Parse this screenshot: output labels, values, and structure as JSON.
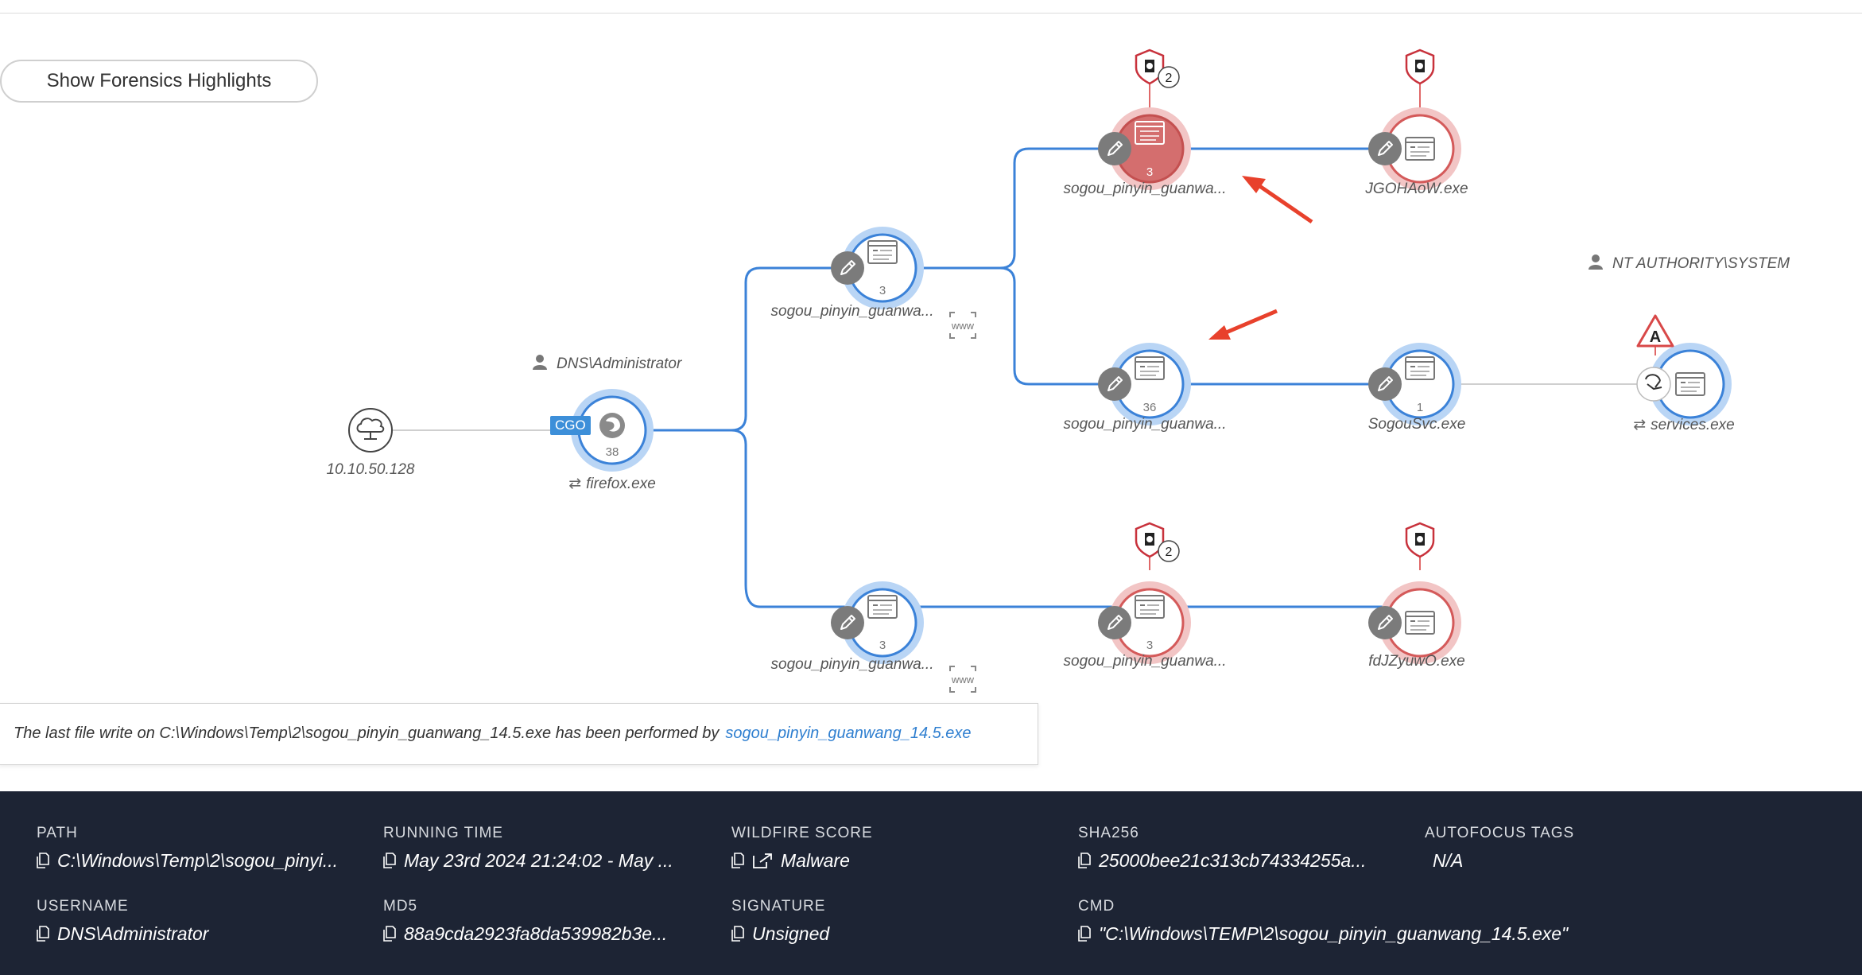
{
  "toolbar": {
    "forensics_button": "Show Forensics Highlights"
  },
  "colors": {
    "edge": "#3b82d8",
    "benign_ring": "#b9d5f5",
    "malicious_ring": "#f2c5c5",
    "malicious_fill": "#d46e6e",
    "panel_bg": "#1d2434",
    "link": "#2f7fd0"
  },
  "users": {
    "dns_admin": "DNS\\Administrator",
    "nt_system": "NT AUTHORITY\\SYSTEM"
  },
  "nodes": {
    "ip": {
      "label": "10.10.50.128",
      "icon": "cloud-network-icon"
    },
    "firefox": {
      "label": "firefox.exe",
      "count": "38",
      "badge": "CGO",
      "icon": "firefox-icon"
    },
    "sogou_a": {
      "label": "sogou_pinyin_guanwa...",
      "count": "3",
      "icon": "window-icon"
    },
    "sogou_b": {
      "label": "sogou_pinyin_guanwa...",
      "count": "3",
      "alerts": "2",
      "icon": "window-icon"
    },
    "jgohaow": {
      "label": "JGOHAoW.exe",
      "icon": "window-icon"
    },
    "sogou_c": {
      "label": "sogou_pinyin_guanwa...",
      "count": "36",
      "icon": "window-icon"
    },
    "sogousvc": {
      "label": "SogouSvc.exe",
      "count": "1",
      "icon": "window-icon"
    },
    "services": {
      "label": "services.exe",
      "icon": "window-icon",
      "warning": "A"
    },
    "sogou_d": {
      "label": "sogou_pinyin_guanwa...",
      "count": "3",
      "icon": "window-icon"
    },
    "sogou_e": {
      "label": "sogou_pinyin_guanwa...",
      "count": "3",
      "alerts": "2",
      "icon": "window-icon"
    },
    "fdjzyuwo": {
      "label": "fdJZyuwO.exe",
      "icon": "window-icon"
    }
  },
  "www_label": "www",
  "info": {
    "text": "The last file write on C:\\Windows\\Temp\\2\\sogou_pinyin_guanwang_14.5.exe has been performed by",
    "link": "sogou_pinyin_guanwang_14.5.exe"
  },
  "details": {
    "path": {
      "label": "PATH",
      "value": "C:\\Windows\\Temp\\2\\sogou_pinyi..."
    },
    "running_time": {
      "label": "RUNNING TIME",
      "value": "May 23rd 2024 21:24:02 - May ..."
    },
    "wildfire_score": {
      "label": "WILDFIRE SCORE",
      "value": "Malware"
    },
    "sha256": {
      "label": "SHA256",
      "value": "25000bee21c313cb74334255a..."
    },
    "autofocus_tags": {
      "label": "AUTOFOCUS TAGS",
      "value": "N/A"
    },
    "username": {
      "label": "USERNAME",
      "value": "DNS\\Administrator"
    },
    "md5": {
      "label": "MD5",
      "value": "88a9cda2923fa8da539982b3e..."
    },
    "signature": {
      "label": "SIGNATURE",
      "value": "Unsigned"
    },
    "cmd": {
      "label": "CMD",
      "value": "\"C:\\Windows\\TEMP\\2\\sogou_pinyin_guanwang_14.5.exe\""
    }
  }
}
